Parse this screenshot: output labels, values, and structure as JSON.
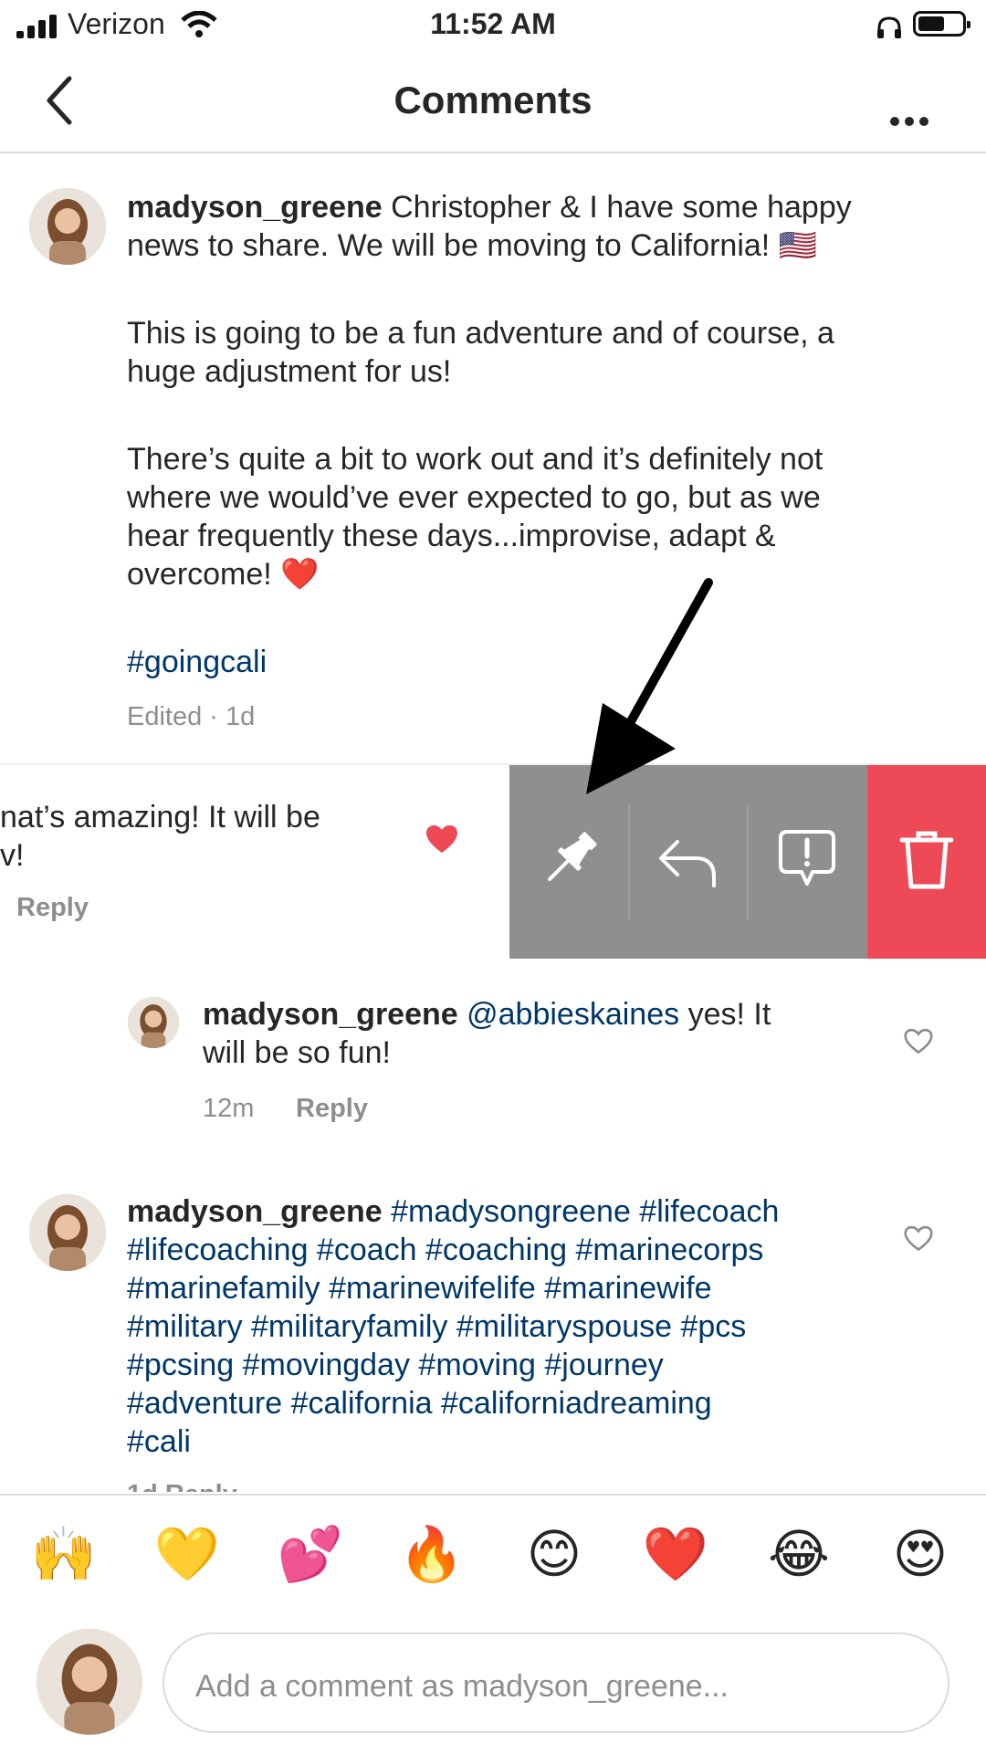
{
  "status_bar": {
    "carrier": "Verizon",
    "time": "11:52 AM"
  },
  "header": {
    "title": "Comments"
  },
  "caption": {
    "username": "madyson_greene",
    "line1": " Christopher & I have some happy",
    "line2": "news to share. We will be moving to California! 🇺🇸",
    "para2_l1": "This is going to be a fun adventure and of course, a",
    "para2_l2": "huge adjustment for us!",
    "para3_l1": "There’s quite a bit to work out and it’s definitely not",
    "para3_l2": "where we would’ve ever expected to go, but as we",
    "para3_l3": "hear frequently these days...improvise, adapt &",
    "para3_l4": "overcome! ❤️",
    "hashtag": "#goingcali",
    "meta": "Edited · 1d"
  },
  "swiped_comment": {
    "line1": "nat’s amazing! It will be",
    "line2": "v!",
    "reply": "Reply"
  },
  "swipe_actions": [
    "pin",
    "reply",
    "report",
    "delete"
  ],
  "reply_comment": {
    "username": "madyson_greene",
    "mention": "@abbieskaines",
    "line1_rest": " yes! It",
    "line2": "will be so fun!",
    "time": "12m",
    "reply": "Reply"
  },
  "hashtag_comment": {
    "username": "madyson_greene",
    "l1": "#madysongreene #lifecoach",
    "l2": "#lifecoaching #coach #coaching #marinecorps",
    "l3": "#marinefamily #marinewifelife #marinewife",
    "l4": "#military #militaryfamily #militaryspouse #pcs",
    "l5": "#pcsing #movingday #moving #journey",
    "l6": "#adventure #california #californiadreaming",
    "l7": "#cali",
    "meta": "1d   Reply"
  },
  "emoji_bar": [
    "🙌",
    "💛",
    "💕",
    "🔥",
    "😊",
    "❤️",
    "😂",
    "😍"
  ],
  "input": {
    "placeholder": "Add a comment as madyson_greene..."
  },
  "colors": {
    "action_gray": "#8f8f8f",
    "delete_red": "#ed4956",
    "hashtag_blue": "#00376b"
  }
}
